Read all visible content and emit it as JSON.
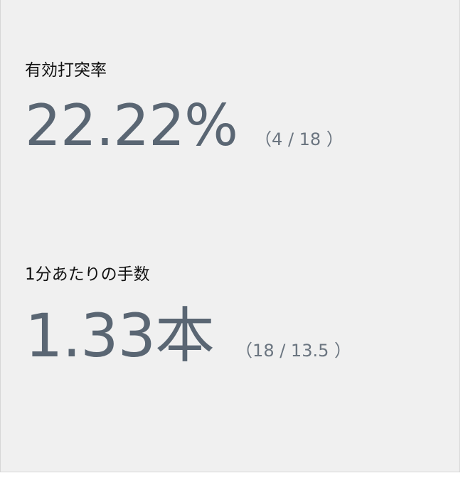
{
  "stats": [
    {
      "label": "有効打突率",
      "value": "22.22%",
      "detail": "（4 / 18 ）"
    },
    {
      "label": "1分あたりの手数",
      "value": "1.33本",
      "detail": "（18 / 13.5 ）"
    }
  ]
}
